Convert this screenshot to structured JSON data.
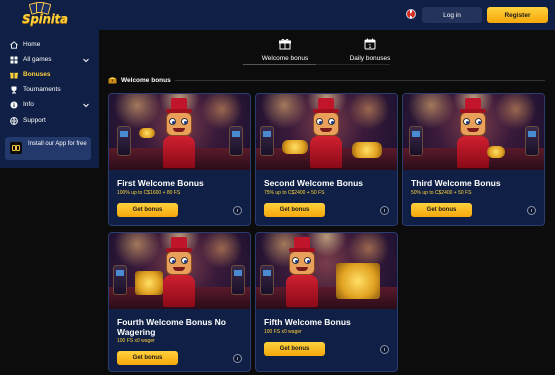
{
  "header": {
    "logo_text": "Spinita",
    "login_label": "Log in",
    "register_label": "Register"
  },
  "sidebar": {
    "items": [
      {
        "label": "Home",
        "icon": "home-icon"
      },
      {
        "label": "All games",
        "icon": "grid-icon"
      },
      {
        "label": "Bonuses",
        "icon": "gift-icon"
      },
      {
        "label": "Tournaments",
        "icon": "trophy-icon"
      },
      {
        "label": "Info",
        "icon": "info-icon"
      },
      {
        "label": "Support",
        "icon": "globe-icon"
      }
    ],
    "install": "Install our App for free"
  },
  "tabs": [
    {
      "label": "Welcome bonus",
      "icon": "gift-box-icon"
    },
    {
      "label": "Daily bonuses",
      "icon": "calendar-icon"
    }
  ],
  "section": {
    "title": "Welcome bonus"
  },
  "cards": [
    {
      "title": "First Welcome Bonus",
      "subtitle": "100% up to C$1600 + 80 FS",
      "button": "Get bonus"
    },
    {
      "title": "Second Welcome Bonus",
      "subtitle": "75% up to C$2400 + 50 FS",
      "button": "Get bonus"
    },
    {
      "title": "Third Welcome Bonus",
      "subtitle": "50% up to C$2400 + 50 FS",
      "button": "Get bonus"
    },
    {
      "title": "Fourth Welcome Bonus No Wagering",
      "subtitle": "100 FS x0 wager",
      "button": "Get bonus"
    },
    {
      "title": "Fifth Welcome Bonus",
      "subtitle": "100 FS x0 wager",
      "button": "Get bonus"
    }
  ],
  "colors": {
    "header_bg": "#0f1f45",
    "accent": "#ffd13a",
    "page_bg": "#0c0c0c"
  }
}
